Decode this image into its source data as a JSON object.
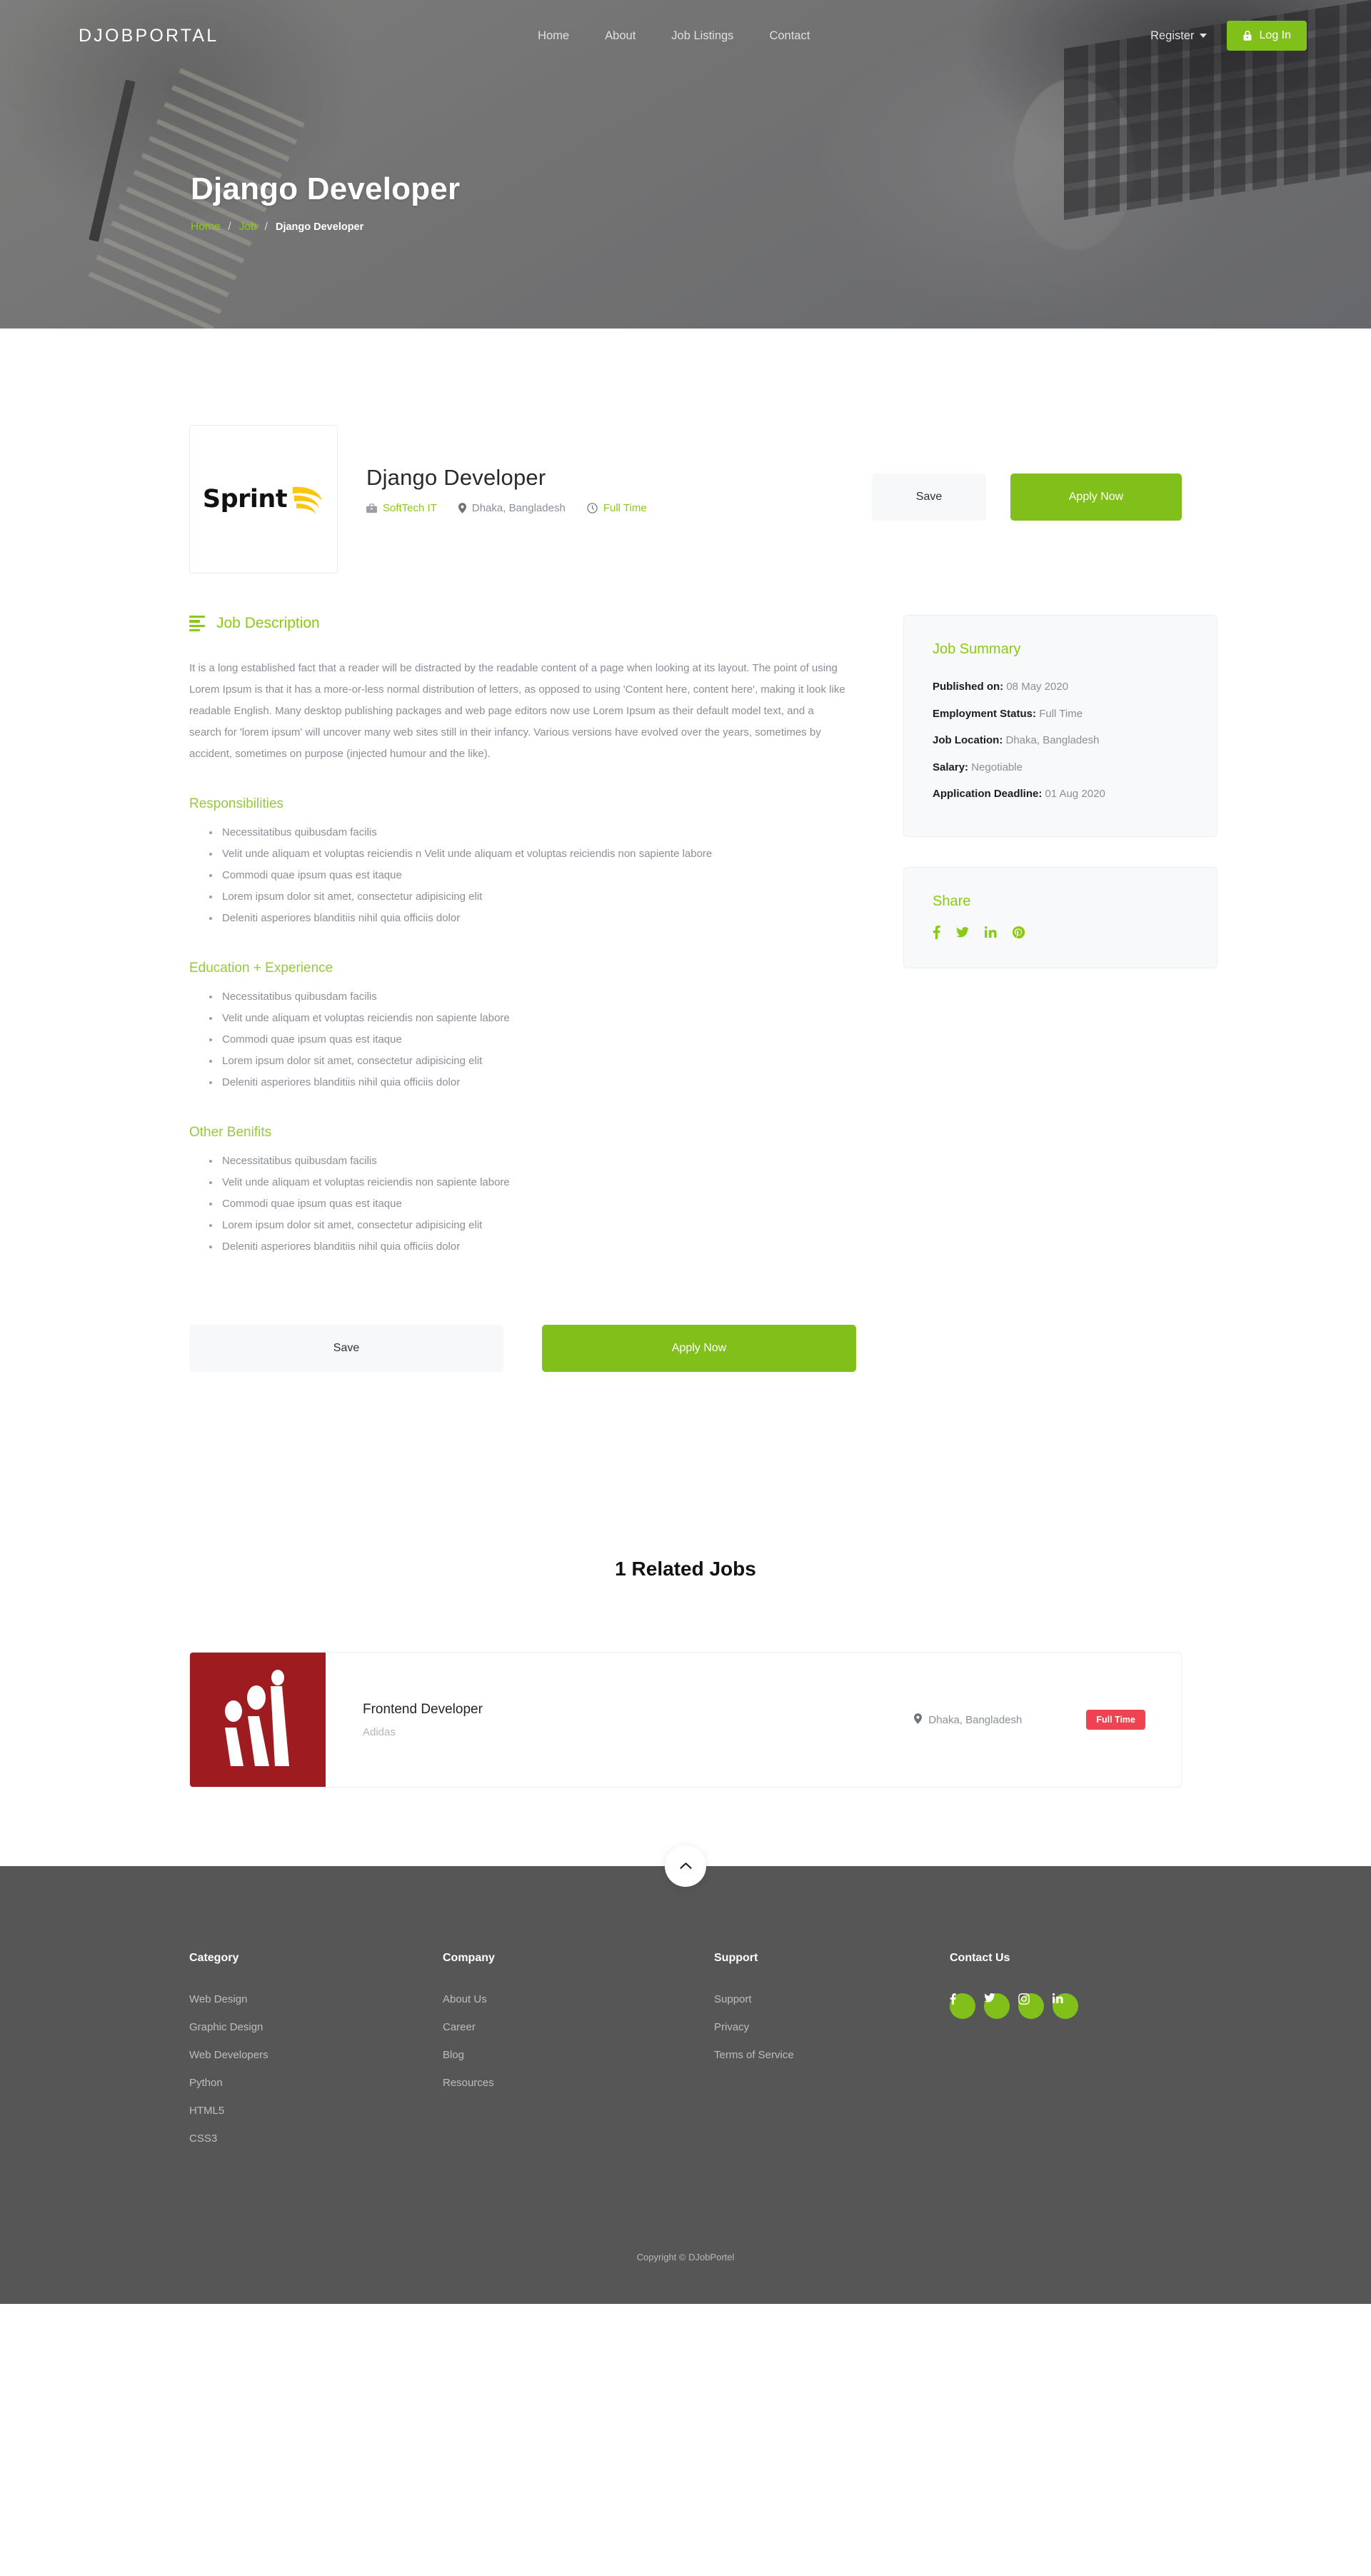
{
  "brand": {
    "name": "DJOBPORTAL"
  },
  "nav": {
    "links": [
      {
        "label": "Home"
      },
      {
        "label": "About"
      },
      {
        "label": "Job Listings"
      },
      {
        "label": "Contact"
      }
    ],
    "register_label": "Register",
    "login_label": "Log In"
  },
  "hero": {
    "title": "Django Developer",
    "breadcrumb": {
      "home": "Home",
      "job": "Job",
      "current": "Django Developer",
      "separator": "/"
    }
  },
  "job": {
    "logo_text": "Sprint",
    "title": "Django Developer",
    "company": "SoftTech IT",
    "location": "Dhaka, Bangladesh",
    "type": "Full Time"
  },
  "actions": {
    "save_label": "Save",
    "apply_label": "Apply Now"
  },
  "description": {
    "heading": "Job Description",
    "body": "It is a long established fact that a reader will be distracted by the readable content of a page when looking at its layout. The point of using Lorem Ipsum is that it has a more-or-less normal distribution of letters, as opposed to using 'Content here, content here', making it look like readable English. Many desktop publishing packages and web page editors now use Lorem Ipsum as their default model text, and a search for 'lorem ipsum' will uncover many web sites still in their infancy. Various versions have evolved over the years, sometimes by accident, sometimes on purpose (injected humour and the like)."
  },
  "responsibilities": {
    "heading": "Responsibilities",
    "items": [
      "Necessitatibus quibusdam facilis",
      "Velit unde aliquam et voluptas reiciendis n Velit unde aliquam et voluptas reiciendis non sapiente labore",
      "Commodi quae ipsum quas est itaque",
      "Lorem ipsum dolor sit amet, consectetur adipisicing elit",
      "Deleniti asperiores blanditiis nihil quia officiis dolor"
    ]
  },
  "education": {
    "heading": "Education + Experience",
    "items": [
      "Necessitatibus quibusdam facilis",
      "Velit unde aliquam et voluptas reiciendis non sapiente labore",
      "Commodi quae ipsum quas est itaque",
      "Lorem ipsum dolor sit amet, consectetur adipisicing elit",
      "Deleniti asperiores blanditiis nihil quia officiis dolor"
    ]
  },
  "benefits": {
    "heading": "Other Benifits",
    "items": [
      "Necessitatibus quibusdam facilis",
      "Velit unde aliquam et voluptas reiciendis non sapiente labore",
      "Commodi quae ipsum quas est itaque",
      "Lorem ipsum dolor sit amet, consectetur adipisicing elit",
      "Deleniti asperiores blanditiis nihil quia officiis dolor"
    ]
  },
  "summary": {
    "title": "Job Summary",
    "rows": [
      {
        "label": "Published on:",
        "value": "08 May 2020"
      },
      {
        "label": "Employment Status:",
        "value": "Full Time"
      },
      {
        "label": "Job Location:",
        "value": "Dhaka, Bangladesh"
      },
      {
        "label": "Salary:",
        "value": "Negotiable"
      },
      {
        "label": "Application Deadline:",
        "value": "01 Aug 2020"
      }
    ]
  },
  "share": {
    "title": "Share",
    "networks": [
      "facebook",
      "twitter",
      "linkedin",
      "pinterest"
    ]
  },
  "related": {
    "heading": "1 Related Jobs",
    "jobs": [
      {
        "title": "Frontend Developer",
        "company": "Adidas",
        "location": "Dhaka, Bangladesh",
        "badge": "Full Time"
      }
    ]
  },
  "footer": {
    "columns": [
      {
        "heading": "Category",
        "links": [
          "Web Design",
          "Graphic Design",
          "Web Developers",
          "Python",
          "HTML5",
          "CSS3"
        ]
      },
      {
        "heading": "Company",
        "links": [
          "About Us",
          "Career",
          "Blog",
          "Resources"
        ]
      },
      {
        "heading": "Support",
        "links": [
          "Support",
          "Privacy",
          "Terms of Service"
        ]
      }
    ],
    "contact": {
      "heading": "Contact Us",
      "socials": [
        "facebook",
        "twitter",
        "instagram",
        "linkedin"
      ]
    },
    "copyright": "Copyright © DJobPortel"
  },
  "colors": {
    "accent_green": "#81c01b",
    "title_green": "#8bc918",
    "badge_red": "#ef4351",
    "footer_bg": "#565656",
    "muted_text": "#8a8f97"
  }
}
